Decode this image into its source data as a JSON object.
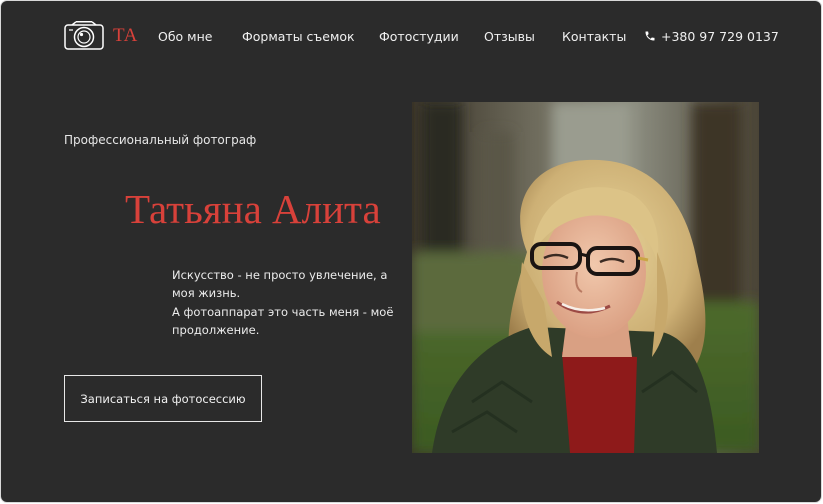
{
  "brand": {
    "logo_text": "TA"
  },
  "nav": {
    "items": [
      {
        "label": "Обо мне"
      },
      {
        "label": "Форматы съемок"
      },
      {
        "label": "Фотостудии"
      },
      {
        "label": "Отзывы"
      },
      {
        "label": "Контакты"
      }
    ],
    "phone": "+380 97 729 0137",
    "phone_icon": "phone-icon"
  },
  "hero": {
    "subtitle": "Профессиональный фотограф",
    "name": "Татьяна Алита",
    "bio_lines": [
      "Искусство - не просто увлечение, а",
      "моя жизнь.",
      "А фотоаппарат это часть меня - моё",
      "продолжение."
    ],
    "cta_label": "Записаться на фотосессию"
  },
  "colors": {
    "background": "#2b2b2b",
    "accent": "#d8413a",
    "text": "#f0f0f0"
  }
}
